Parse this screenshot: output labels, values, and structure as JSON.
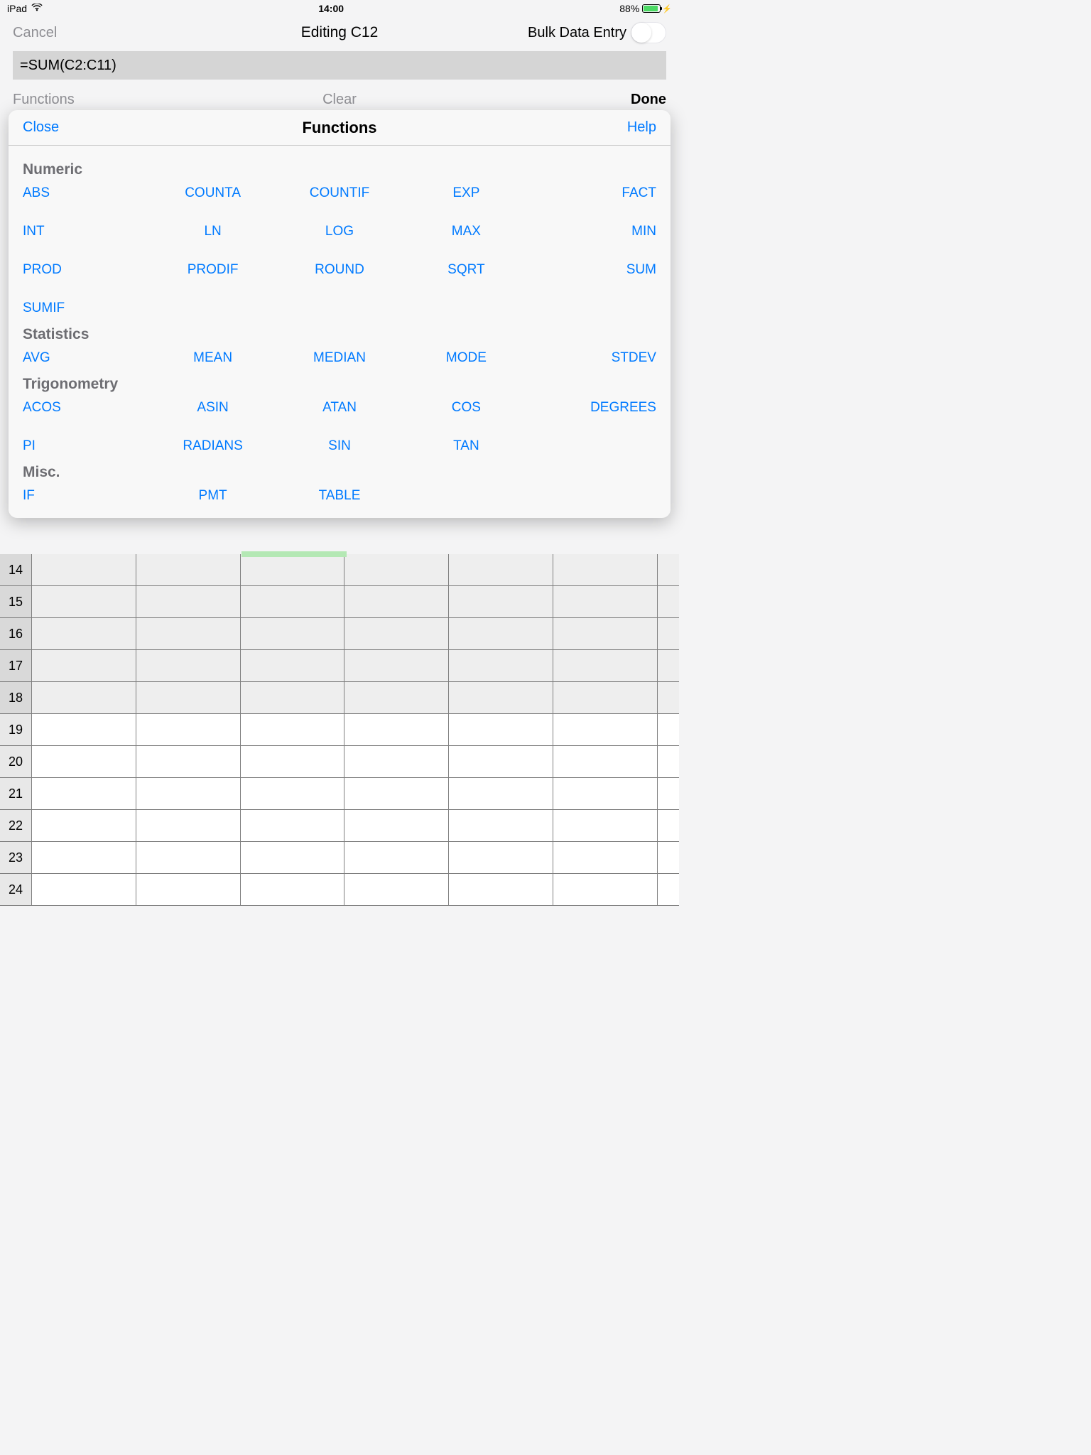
{
  "status": {
    "device": "iPad",
    "time": "14:00",
    "battery_pct": "88%"
  },
  "nav": {
    "cancel": "Cancel",
    "title": "Editing C12",
    "bulk_label": "Bulk Data Entry"
  },
  "formula": "=SUM(C2:C11)",
  "actions": {
    "functions": "Functions",
    "clear": "Clear",
    "done": "Done"
  },
  "popover": {
    "close": "Close",
    "title": "Functions",
    "help": "Help",
    "sections": [
      {
        "name": "Numeric",
        "items": [
          "ABS",
          "COUNTA",
          "COUNTIF",
          "EXP",
          "FACT",
          "INT",
          "LN",
          "LOG",
          "MAX",
          "MIN",
          "PROD",
          "PRODIF",
          "ROUND",
          "SQRT",
          "SUM",
          "SUMIF"
        ]
      },
      {
        "name": "Statistics",
        "items": [
          "AVG",
          "MEAN",
          "MEDIAN",
          "MODE",
          "STDEV"
        ]
      },
      {
        "name": "Trigonometry",
        "items": [
          "ACOS",
          "ASIN",
          "ATAN",
          "COS",
          "DEGREES",
          "PI",
          "RADIANS",
          "SIN",
          "TAN"
        ]
      },
      {
        "name": "Misc.",
        "items": [
          "IF",
          "PMT",
          "TABLE"
        ]
      }
    ]
  },
  "sheet": {
    "visible_rows": [
      "14",
      "15",
      "16",
      "17",
      "18",
      "19",
      "20",
      "21",
      "22",
      "23",
      "24"
    ],
    "columns": 6
  }
}
